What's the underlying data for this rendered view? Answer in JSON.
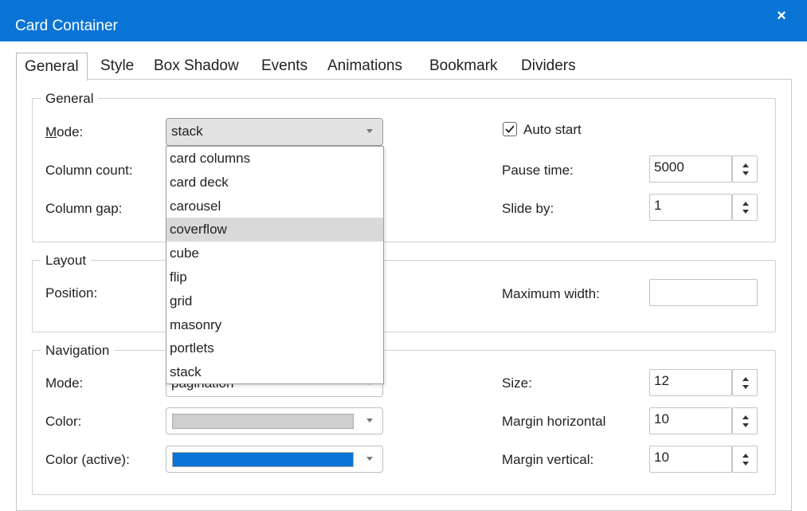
{
  "window": {
    "title": "Card Container",
    "close_icon": "×"
  },
  "tabs": [
    "General",
    "Style",
    "Box Shadow",
    "Events",
    "Animations",
    "Bookmark",
    "Dividers"
  ],
  "general": {
    "legend": "General",
    "mode_label_prefix": "M",
    "mode_label_rest": "ode:",
    "mode_value": "stack",
    "column_count_label": "Column count:",
    "column_gap_label": "Column gap:",
    "auto_start_label": "Auto start",
    "auto_start_checked": true,
    "pause_time_label": "Pause time:",
    "pause_time_value": "5000",
    "slide_by_label": "Slide by:",
    "slide_by_value": "1"
  },
  "layout": {
    "legend": "Layout",
    "position_label": "Position:",
    "max_width_label": "Maximum width:",
    "max_width_value": ""
  },
  "navigation": {
    "legend": "Navigation",
    "mode_label": "Mode:",
    "mode_value": "pagination",
    "color_label": "Color:",
    "color_value": "#cfcfcf",
    "color_active_label": "Color (active):",
    "color_active_value": "#0a74d6",
    "size_label": "Size:",
    "size_value": "12",
    "margin_h_label": "Margin horizontal",
    "margin_h_value": "10",
    "margin_v_label": "Margin vertical:",
    "margin_v_value": "10"
  },
  "mode_dropdown": {
    "options": [
      "card columns",
      "card deck",
      "carousel",
      "coverflow",
      "cube",
      "flip",
      "grid",
      "masonry",
      "portlets",
      "stack"
    ],
    "highlighted": "coverflow"
  }
}
